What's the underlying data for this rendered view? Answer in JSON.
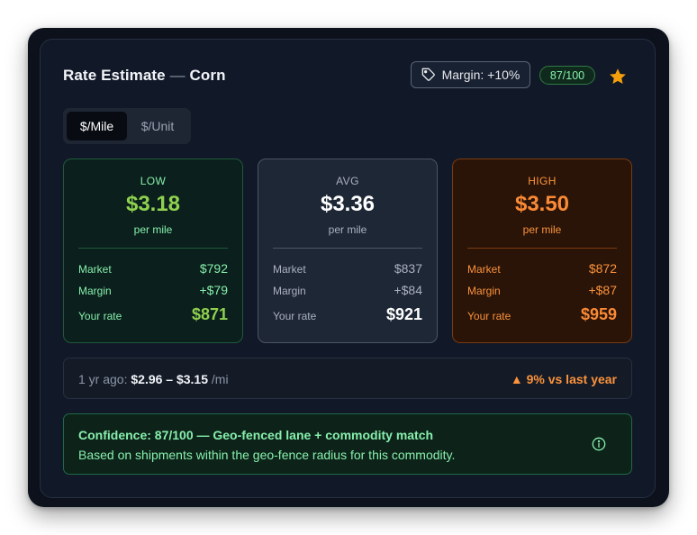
{
  "header": {
    "title_main": "Rate Estimate",
    "title_sep": "—",
    "title_commodity": "Corn",
    "margin_label": "Margin: +10%",
    "score_badge": "87/100",
    "star_icon": "star-icon",
    "tag_icon": "tag-icon"
  },
  "toggle": {
    "options": [
      "$/Mile",
      "$/Unit"
    ],
    "selected": "$/Mile"
  },
  "tiers": [
    {
      "label": "LOW",
      "price": "$3.18",
      "unit": "per mile",
      "rows": [
        {
          "k": "Market",
          "v": "$792"
        },
        {
          "k": "Margin",
          "v": "+$79"
        },
        {
          "k": "Your rate",
          "v": "$871"
        }
      ]
    },
    {
      "label": "AVG",
      "price": "$3.36",
      "unit": "per mile",
      "rows": [
        {
          "k": "Market",
          "v": "$837"
        },
        {
          "k": "Margin",
          "v": "+$84"
        },
        {
          "k": "Your rate",
          "v": "$921"
        }
      ]
    },
    {
      "label": "HIGH",
      "price": "$3.50",
      "unit": "per mile",
      "rows": [
        {
          "k": "Market",
          "v": "$872"
        },
        {
          "k": "Margin",
          "v": "+$87"
        },
        {
          "k": "Your rate",
          "v": "$959"
        }
      ]
    }
  ],
  "history": {
    "prefix": "1 yr ago:",
    "range": "$2.96 – $3.15",
    "suffix": "/mi",
    "change": "▲ 9% vs last year"
  },
  "confidence": {
    "headline": "Confidence: 87/100 — Geo-fenced lane + commodity match",
    "detail": "Based on shipments within the geo-fence radius for this commodity.",
    "info_icon": "info-icon"
  },
  "colors": {
    "low_accent": "#8fd14f",
    "high_accent": "#fb8a36",
    "confidence_green": "#86efac",
    "star": "#f59e0b"
  }
}
